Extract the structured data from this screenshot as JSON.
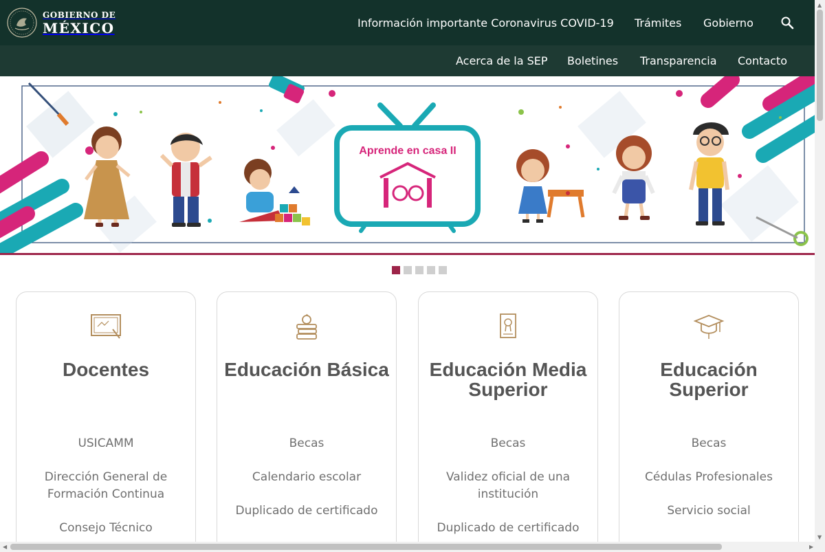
{
  "header": {
    "logo_line1": "GOBIERNO DE",
    "logo_line2": "MÉXICO",
    "nav": [
      {
        "label": "Información importante Coronavirus COVID-19"
      },
      {
        "label": "Trámites"
      },
      {
        "label": "Gobierno"
      }
    ],
    "search_icon": "search-icon"
  },
  "subnav": {
    "items": [
      {
        "label": "Acerca de la SEP"
      },
      {
        "label": "Boletines"
      },
      {
        "label": "Transparencia"
      },
      {
        "label": "Contacto"
      }
    ]
  },
  "banner": {
    "title": "Aprende en casa II"
  },
  "carousel": {
    "slides": 5,
    "active": 1
  },
  "cards": [
    {
      "title": "Docentes",
      "icon": "chalkboard-icon",
      "links": [
        "USICAMM",
        "Dirección General de Formación Continua",
        "Consejo Técnico"
      ]
    },
    {
      "title": "Educación Básica",
      "icon": "books-apple-icon",
      "links": [
        "Becas",
        "Calendario escolar",
        "Duplicado de certificado"
      ]
    },
    {
      "title": "Educación Media Superior",
      "icon": "certificate-icon",
      "links": [
        "Becas",
        "Validez oficial de una institución",
        "Duplicado de certificado"
      ]
    },
    {
      "title": "Educación Superior",
      "icon": "graduation-cap-icon",
      "links": [
        "Becas",
        "Cédulas Profesionales",
        "Servicio social"
      ]
    }
  ],
  "colors": {
    "header_bg": "#13322b",
    "subnav_bg": "#1e3a33",
    "accent": "#9d2449",
    "icon_gold": "#b38e5d"
  }
}
